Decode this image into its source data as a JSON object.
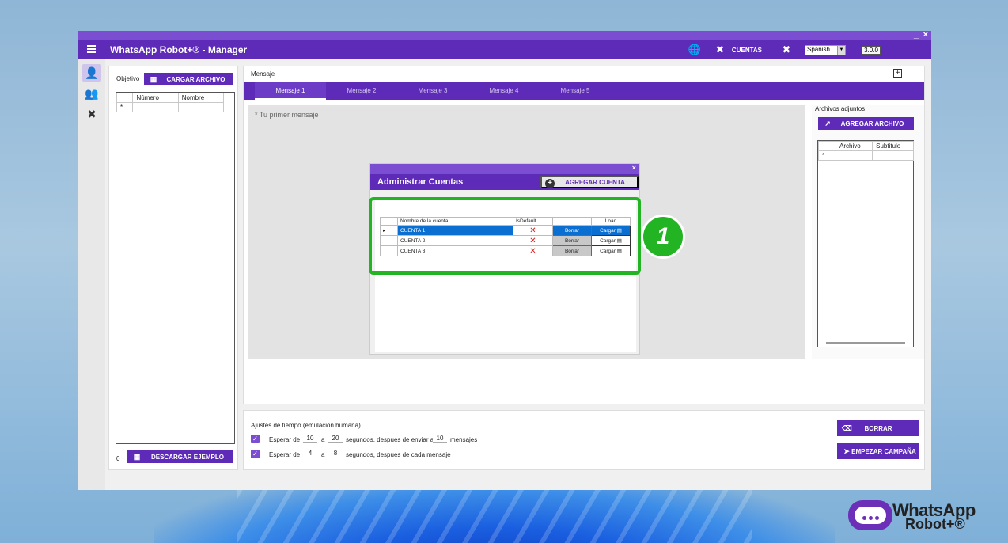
{
  "window": {
    "title": "WhatsApp Robot+® - Manager",
    "min_label": "_",
    "close_label": "×"
  },
  "toolbar": {
    "cuentas_label": "CUENTAS",
    "language": "Spanish",
    "version": "3.0.0"
  },
  "objetivo": {
    "label": "Objetivo",
    "load_button": "CARGAR ARCHIVO",
    "columns": [
      "Número",
      "Nombre"
    ],
    "new_row_marker": "*",
    "count": "0",
    "download_button": "DESCARGAR EJEMPLO"
  },
  "mensaje": {
    "label": "Mensaje",
    "tabs": [
      "Mensaje 1",
      "Mensaje 2",
      "Mensaje 3",
      "Mensaje 4",
      "Mensaje 5"
    ],
    "active_tab": 0,
    "placeholder": "* Tu primer mensaje"
  },
  "adjuntos": {
    "label": "Archivos adjuntos",
    "add_button": "AGREGAR ARCHIVO",
    "columns": [
      "Archivo",
      "Subtitulo"
    ],
    "new_row_marker": "*"
  },
  "dialog": {
    "title": "Administrar Cuentas",
    "close_label": "×",
    "add_button": "AGREGAR CUENTA",
    "columns": [
      "Nombre de la cuenta",
      "IsDefault",
      "",
      "Load"
    ],
    "rows": [
      {
        "name": "CUENTA 1",
        "delete": "Borrar",
        "load": "Cargar"
      },
      {
        "name": "CUENTA 2",
        "delete": "Borrar",
        "load": "Cargar"
      },
      {
        "name": "CUENTA 3",
        "delete": "Borrar",
        "load": "Cargar"
      }
    ],
    "selected_row": 0
  },
  "annotation": {
    "step": "1",
    "accent": "#22b422"
  },
  "timing": {
    "label": "Ajustes de tiempo (emulación humana)",
    "row1": {
      "prefix": "Esperar de",
      "from": "10",
      "to_word": "a",
      "to": "20",
      "mid": "segundos, despues de enviar a",
      "count": "10",
      "suffix": "mensajes"
    },
    "row2": {
      "prefix": "Esperar de",
      "from": "4",
      "to_word": "a",
      "to": "8",
      "mid": "segundos, despues de cada mensaje"
    },
    "clear_button": "BORRAR",
    "start_button": "EMPEZAR CAMPAÑA"
  },
  "brand": {
    "line1": "WhatsApp",
    "line2": "Robot+®",
    "primary": "#5e2ab8"
  }
}
